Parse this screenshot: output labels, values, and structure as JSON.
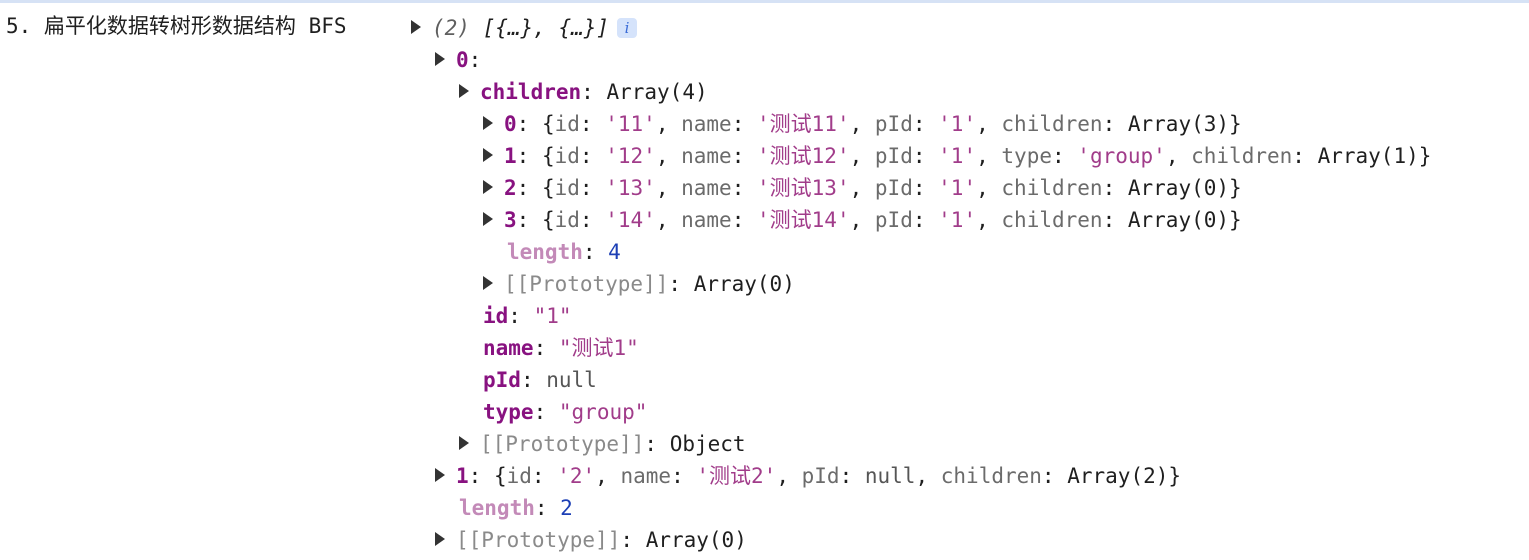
{
  "console_label": "5. 扁平化数据转树形数据结构 BFS",
  "root": {
    "count_text": "(2)",
    "preview_text": "[{…}, {…}]",
    "info_glyph": "i"
  },
  "punct": {
    "colon": ":",
    "comma": ",",
    "open_brace": "{",
    "close_brace": "}"
  },
  "item0": {
    "index": "0",
    "children_key": "children",
    "children_value": "Array(4)",
    "rows": [
      {
        "index": "0",
        "id_key": "id",
        "id_val": "'11'",
        "name_key": "name",
        "name_val": "'测试11'",
        "pid_key": "pId",
        "pid_val": "'1'",
        "children_key": "children",
        "children_val": "Array(3)"
      },
      {
        "index": "1",
        "id_key": "id",
        "id_val": "'12'",
        "name_key": "name",
        "name_val": "'测试12'",
        "pid_key": "pId",
        "pid_val": "'1'",
        "type_key": "type",
        "type_val": "'group'",
        "children_key": "children",
        "children_val": "Array(1)"
      },
      {
        "index": "2",
        "id_key": "id",
        "id_val": "'13'",
        "name_key": "name",
        "name_val": "'测试13'",
        "pid_key": "pId",
        "pid_val": "'1'",
        "children_key": "children",
        "children_val": "Array(0)"
      },
      {
        "index": "3",
        "id_key": "id",
        "id_val": "'14'",
        "name_key": "name",
        "name_val": "'测试14'",
        "pid_key": "pId",
        "pid_val": "'1'",
        "children_key": "children",
        "children_val": "Array(0)"
      }
    ],
    "length_key": "length",
    "length_val": "4",
    "inner_proto_key": "[[Prototype]]",
    "inner_proto_val": "Array(0)",
    "id_key": "id",
    "id_val": "\"1\"",
    "name_key": "name",
    "name_val": "\"测试1\"",
    "pid_key": "pId",
    "pid_val": "null",
    "type_key": "type",
    "type_val": "\"group\"",
    "proto_key": "[[Prototype]]",
    "proto_val": "Object"
  },
  "item1": {
    "index": "1",
    "id_key": "id",
    "id_val": "'2'",
    "name_key": "name",
    "name_val": "'测试2'",
    "pid_key": "pId",
    "pid_val": "null",
    "children_key": "children",
    "children_val": "Array(2)"
  },
  "root_length_key": "length",
  "root_length_val": "2",
  "root_proto_key": "[[Prototype]]",
  "root_proto_val": "Array(0)"
}
